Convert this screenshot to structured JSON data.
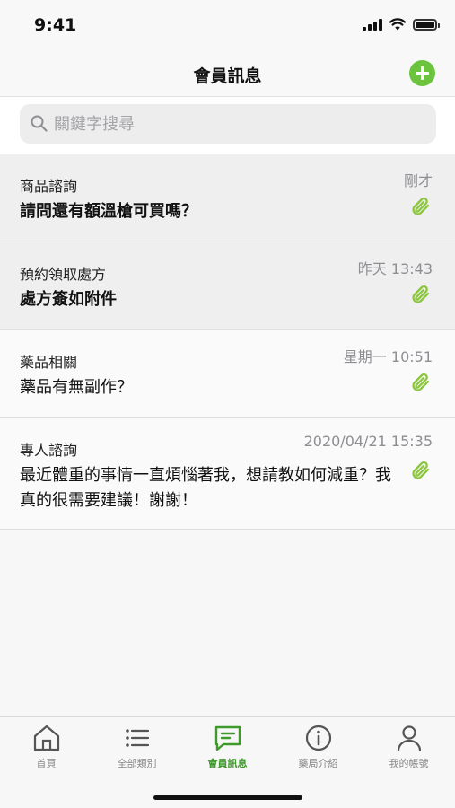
{
  "status_bar": {
    "time": "9:41"
  },
  "nav": {
    "title": "會員訊息"
  },
  "search": {
    "placeholder": "關鍵字搜尋"
  },
  "messages": [
    {
      "category": "商品諮詢",
      "time": "剛才",
      "text": "請問還有額溫槍可買嗎？",
      "unread": true
    },
    {
      "category": "預約領取處方",
      "time": "昨天 13:43",
      "text": "處方簽如附件",
      "unread": true
    },
    {
      "category": "藥品相關",
      "time": "星期一 10:51",
      "text": "藥品有無副作？",
      "unread": false
    },
    {
      "category": "專人諮詢",
      "time": "2020/04/21 15:35",
      "text": "最近體重的事情一直煩惱著我，想請教如何減重？我真的很需要建議！謝謝！",
      "unread": false
    }
  ],
  "tabs": [
    {
      "label": "首頁",
      "icon": "home-icon",
      "active": false
    },
    {
      "label": "全部類別",
      "icon": "list-icon",
      "active": false
    },
    {
      "label": "會員訊息",
      "icon": "message-icon",
      "active": true
    },
    {
      "label": "藥局介紹",
      "icon": "info-icon",
      "active": false
    },
    {
      "label": "我的帳號",
      "icon": "account-icon",
      "active": false
    }
  ],
  "colors": {
    "accent": "#6cc33e",
    "active_tab": "#3f9a2c",
    "attachment": "#8cc63f"
  }
}
